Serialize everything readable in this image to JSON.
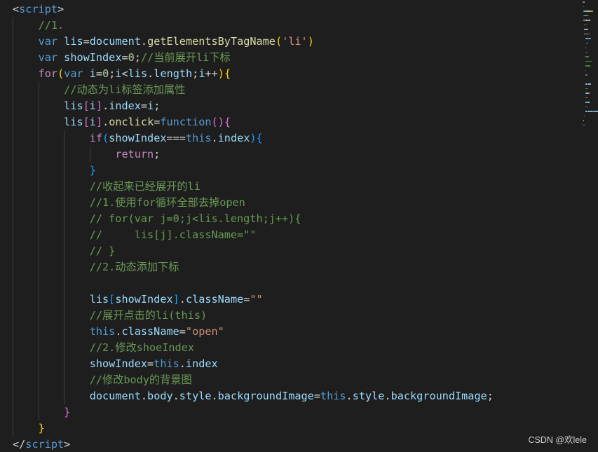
{
  "colors": {
    "background": "#1e1e1e",
    "keyword": "#569cd6",
    "control": "#c586c0",
    "identifier": "#9cdcfe",
    "function": "#dcdcaa",
    "string": "#ce9178",
    "number": "#b5cea8",
    "comment": "#6a9955",
    "bracket_level_1": "#ffd700",
    "bracket_level_2": "#da70d6",
    "bracket_level_3": "#179fff"
  },
  "editor": {
    "code_lines": [
      [
        {
          "t": "<",
          "c": "pn"
        },
        {
          "t": "script",
          "c": "tag"
        },
        {
          "t": ">",
          "c": "pn"
        }
      ],
      [
        {
          "t": "    ",
          "c": "pn"
        },
        {
          "t": "//1.",
          "c": "cm"
        }
      ],
      [
        {
          "t": "    ",
          "c": "pn"
        },
        {
          "t": "var",
          "c": "kw"
        },
        {
          "t": " ",
          "c": "pn"
        },
        {
          "t": "lis",
          "c": "id"
        },
        {
          "t": "=",
          "c": "pn"
        },
        {
          "t": "document",
          "c": "id"
        },
        {
          "t": ".",
          "c": "pn"
        },
        {
          "t": "getElementsByTagName",
          "c": "fn"
        },
        {
          "t": "(",
          "c": "br1"
        },
        {
          "t": "'li'",
          "c": "str"
        },
        {
          "t": ")",
          "c": "br1"
        }
      ],
      [
        {
          "t": "    ",
          "c": "pn"
        },
        {
          "t": "var",
          "c": "kw"
        },
        {
          "t": " ",
          "c": "pn"
        },
        {
          "t": "showIndex",
          "c": "id"
        },
        {
          "t": "=",
          "c": "pn"
        },
        {
          "t": "0",
          "c": "num"
        },
        {
          "t": ";",
          "c": "pn"
        },
        {
          "t": "//当前展开li下标",
          "c": "cm"
        }
      ],
      [
        {
          "t": "    ",
          "c": "pn"
        },
        {
          "t": "for",
          "c": "ctl"
        },
        {
          "t": "(",
          "c": "br1"
        },
        {
          "t": "var",
          "c": "kw"
        },
        {
          "t": " ",
          "c": "pn"
        },
        {
          "t": "i",
          "c": "id"
        },
        {
          "t": "=",
          "c": "pn"
        },
        {
          "t": "0",
          "c": "num"
        },
        {
          "t": ";",
          "c": "pn"
        },
        {
          "t": "i",
          "c": "id"
        },
        {
          "t": "<",
          "c": "pn"
        },
        {
          "t": "lis",
          "c": "id"
        },
        {
          "t": ".",
          "c": "pn"
        },
        {
          "t": "length",
          "c": "id"
        },
        {
          "t": ";",
          "c": "pn"
        },
        {
          "t": "i",
          "c": "id"
        },
        {
          "t": "++",
          "c": "pn"
        },
        {
          "t": ")",
          "c": "br1"
        },
        {
          "t": "{",
          "c": "br1"
        }
      ],
      [
        {
          "t": "        ",
          "c": "pn"
        },
        {
          "t": "//动态为li标签添加属性",
          "c": "cm"
        }
      ],
      [
        {
          "t": "        ",
          "c": "pn"
        },
        {
          "t": "lis",
          "c": "id"
        },
        {
          "t": "[",
          "c": "br2"
        },
        {
          "t": "i",
          "c": "id"
        },
        {
          "t": "]",
          "c": "br2"
        },
        {
          "t": ".",
          "c": "pn"
        },
        {
          "t": "index",
          "c": "id"
        },
        {
          "t": "=",
          "c": "pn"
        },
        {
          "t": "i",
          "c": "id"
        },
        {
          "t": ";",
          "c": "pn"
        }
      ],
      [
        {
          "t": "        ",
          "c": "pn"
        },
        {
          "t": "lis",
          "c": "id"
        },
        {
          "t": "[",
          "c": "br2"
        },
        {
          "t": "i",
          "c": "id"
        },
        {
          "t": "]",
          "c": "br2"
        },
        {
          "t": ".",
          "c": "pn"
        },
        {
          "t": "onclick",
          "c": "fn"
        },
        {
          "t": "=",
          "c": "pn"
        },
        {
          "t": "function",
          "c": "kw"
        },
        {
          "t": "(",
          "c": "br2"
        },
        {
          "t": ")",
          "c": "br2"
        },
        {
          "t": "{",
          "c": "br2"
        }
      ],
      [
        {
          "t": "            ",
          "c": "pn"
        },
        {
          "t": "if",
          "c": "ctl"
        },
        {
          "t": "(",
          "c": "br3"
        },
        {
          "t": "showIndex",
          "c": "id"
        },
        {
          "t": "===",
          "c": "pn"
        },
        {
          "t": "this",
          "c": "kw"
        },
        {
          "t": ".",
          "c": "pn"
        },
        {
          "t": "index",
          "c": "id"
        },
        {
          "t": ")",
          "c": "br3"
        },
        {
          "t": "{",
          "c": "br3"
        }
      ],
      [
        {
          "t": "                ",
          "c": "pn"
        },
        {
          "t": "return",
          "c": "ctl"
        },
        {
          "t": ";",
          "c": "pn"
        }
      ],
      [
        {
          "t": "            ",
          "c": "pn"
        },
        {
          "t": "}",
          "c": "br3"
        }
      ],
      [
        {
          "t": "            ",
          "c": "pn"
        },
        {
          "t": "//收起来已经展开的li",
          "c": "cm"
        }
      ],
      [
        {
          "t": "            ",
          "c": "pn"
        },
        {
          "t": "//1.使用for循环全部去掉open",
          "c": "cm"
        }
      ],
      [
        {
          "t": "            ",
          "c": "pn"
        },
        {
          "t": "// for(var j=0;j<lis.length;j++){",
          "c": "cm"
        }
      ],
      [
        {
          "t": "            ",
          "c": "pn"
        },
        {
          "t": "//     lis[j].className=\"\"",
          "c": "cm"
        }
      ],
      [
        {
          "t": "            ",
          "c": "pn"
        },
        {
          "t": "// }",
          "c": "cm"
        }
      ],
      [
        {
          "t": "            ",
          "c": "pn"
        },
        {
          "t": "//2.动态添加下标",
          "c": "cm"
        }
      ],
      [],
      [
        {
          "t": "            ",
          "c": "pn"
        },
        {
          "t": "lis",
          "c": "id"
        },
        {
          "t": "[",
          "c": "br3"
        },
        {
          "t": "showIndex",
          "c": "id"
        },
        {
          "t": "]",
          "c": "br3"
        },
        {
          "t": ".",
          "c": "pn"
        },
        {
          "t": "className",
          "c": "id"
        },
        {
          "t": "=",
          "c": "pn"
        },
        {
          "t": "\"\"",
          "c": "str"
        }
      ],
      [
        {
          "t": "            ",
          "c": "pn"
        },
        {
          "t": "//展开点击的li(this)",
          "c": "cm"
        }
      ],
      [
        {
          "t": "            ",
          "c": "pn"
        },
        {
          "t": "this",
          "c": "kw"
        },
        {
          "t": ".",
          "c": "pn"
        },
        {
          "t": "className",
          "c": "id"
        },
        {
          "t": "=",
          "c": "pn"
        },
        {
          "t": "\"open\"",
          "c": "str"
        }
      ],
      [
        {
          "t": "            ",
          "c": "pn"
        },
        {
          "t": "//2.修改shoeIndex",
          "c": "cm"
        }
      ],
      [
        {
          "t": "            ",
          "c": "pn"
        },
        {
          "t": "showIndex",
          "c": "id"
        },
        {
          "t": "=",
          "c": "pn"
        },
        {
          "t": "this",
          "c": "kw"
        },
        {
          "t": ".",
          "c": "pn"
        },
        {
          "t": "index",
          "c": "id"
        }
      ],
      [
        {
          "t": "            ",
          "c": "pn"
        },
        {
          "t": "//修改body的背景图",
          "c": "cm"
        }
      ],
      [
        {
          "t": "            ",
          "c": "pn"
        },
        {
          "t": "document",
          "c": "id"
        },
        {
          "t": ".",
          "c": "pn"
        },
        {
          "t": "body",
          "c": "id"
        },
        {
          "t": ".",
          "c": "pn"
        },
        {
          "t": "style",
          "c": "id"
        },
        {
          "t": ".",
          "c": "pn"
        },
        {
          "t": "backgroundImage",
          "c": "id"
        },
        {
          "t": "=",
          "c": "pn"
        },
        {
          "t": "this",
          "c": "kw"
        },
        {
          "t": ".",
          "c": "pn"
        },
        {
          "t": "style",
          "c": "id"
        },
        {
          "t": ".",
          "c": "pn"
        },
        {
          "t": "backgroundImage",
          "c": "id"
        },
        {
          "t": ";",
          "c": "pn"
        }
      ],
      [
        {
          "t": "        ",
          "c": "pn"
        },
        {
          "t": "}",
          "c": "br2"
        }
      ],
      [
        {
          "t": "    ",
          "c": "pn"
        },
        {
          "t": "}",
          "c": "br1"
        }
      ],
      [
        {
          "t": "</",
          "c": "pn"
        },
        {
          "t": "script",
          "c": "tag"
        },
        {
          "t": ">",
          "c": "pn"
        }
      ]
    ]
  },
  "watermark": {
    "text": "CSDN @欢lele"
  }
}
